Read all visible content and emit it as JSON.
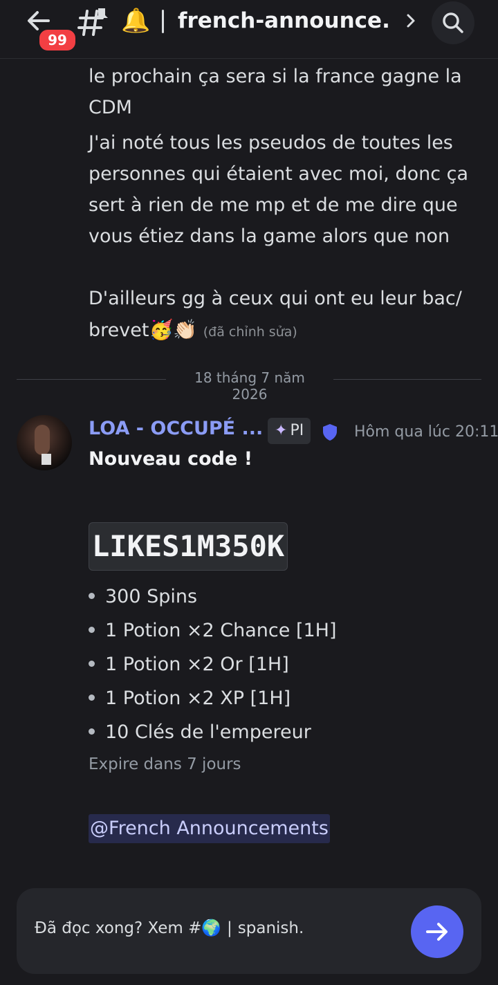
{
  "header": {
    "unread_badge": "99",
    "title": "french-announce...",
    "icons": [
      "back-arrow-icon",
      "announcement-channel-icon",
      "bell-icon",
      "chevron-right-icon",
      "search-icon"
    ]
  },
  "previous_message": {
    "line1": "le prochain ça sera si la france gagne la CDM",
    "line2": "J'ai noté tous les pseudos de toutes les personnes qui étaient avec moi, donc ça sert à rien de me mp et de me dire que vous étiez dans la game alors que non",
    "line3": "D'ailleurs gg à ceux qui ont eu leur bac/ brevet",
    "emojis": "🥳👏🏻",
    "edited": "(đã chỉnh sửa)"
  },
  "date_divider": "18 tháng 7 năm 2026",
  "message": {
    "author": "LOA - OCCUPÉ ...",
    "tag": "PI",
    "timestamp": "Hôm qua lúc 20:11",
    "heading": "Nouveau code !",
    "code": "LIKES1M350K",
    "rewards": [
      "300 Spins",
      "1 Potion ×2 Chance [1H]",
      "1 Potion ×2 Or [1H]",
      "1 Potion ×2 XP [1H]",
      "10 Clés de l'empereur"
    ],
    "expiry": "Expire dans 7 jours",
    "mention": "@French Announcements"
  },
  "footer": {
    "prompt": "Đã đọc xong? Xem #",
    "globe": "🌍",
    "channel": "spanish."
  },
  "colors": {
    "background": "#1a1a1e",
    "username": "#8b9cf5",
    "accent": "#5865f2",
    "badge": "#f23f43"
  }
}
